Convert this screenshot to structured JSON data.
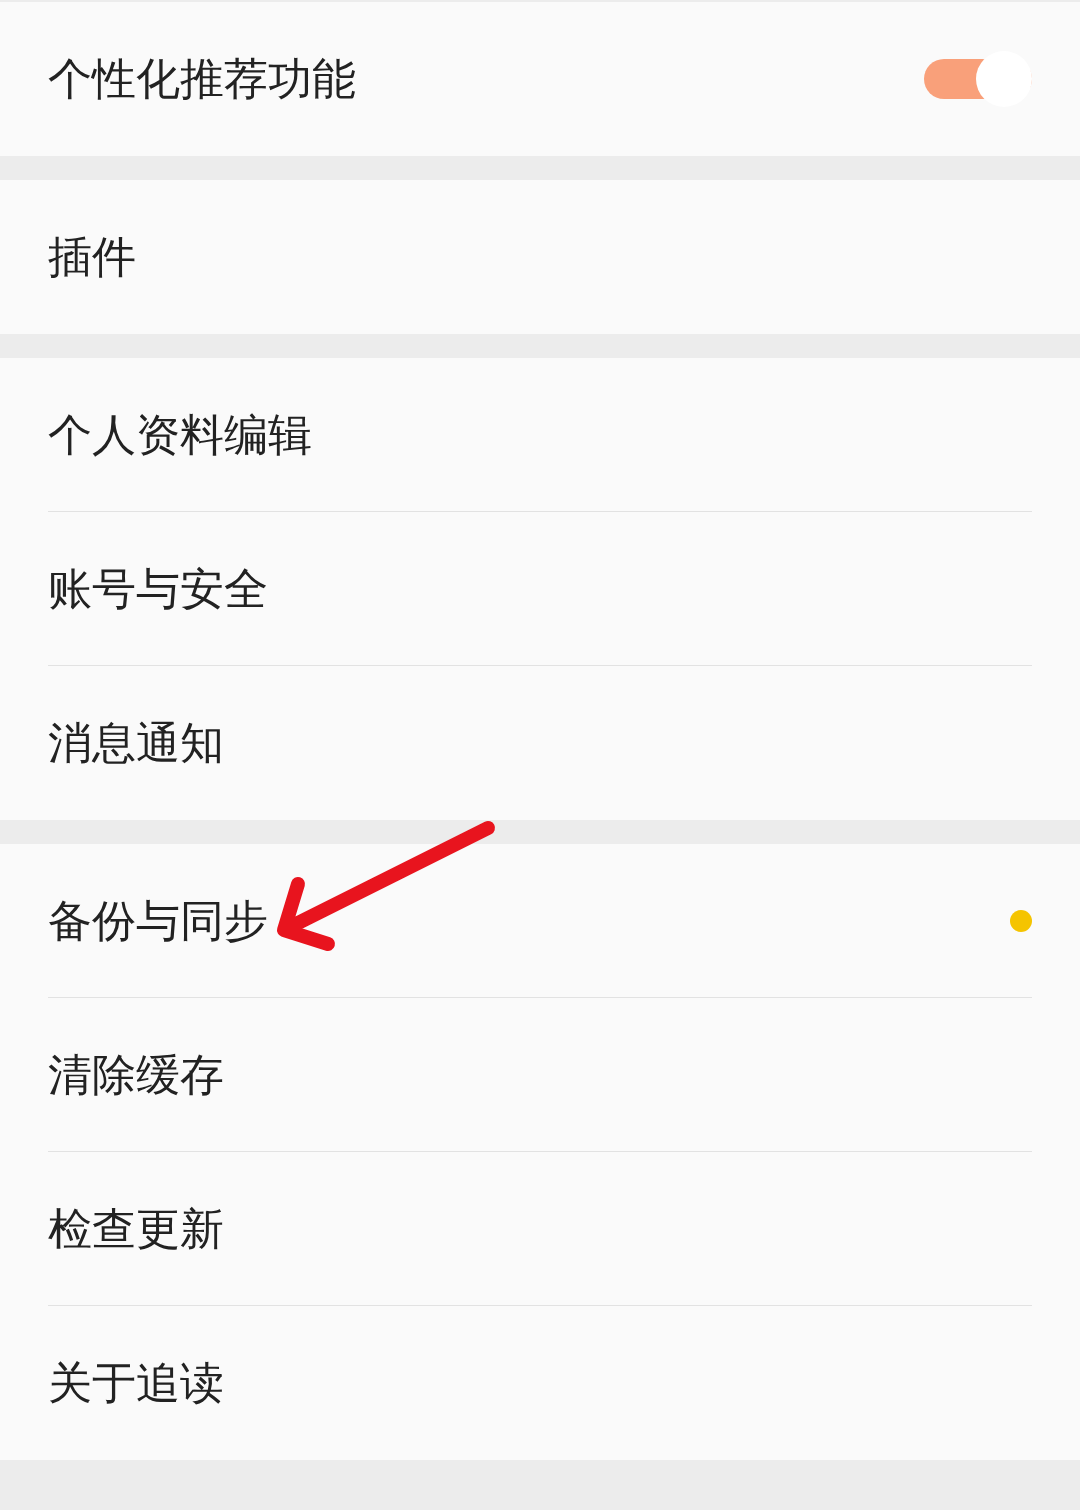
{
  "groups": [
    {
      "items": [
        {
          "label": "个性化推荐功能",
          "kind": "toggle",
          "on": true,
          "dot": false
        }
      ]
    },
    {
      "items": [
        {
          "label": "插件",
          "kind": "link",
          "dot": false
        }
      ]
    },
    {
      "items": [
        {
          "label": "个人资料编辑",
          "kind": "link",
          "dot": false
        },
        {
          "label": "账号与安全",
          "kind": "link",
          "dot": false
        },
        {
          "label": "消息通知",
          "kind": "link",
          "dot": false
        }
      ]
    },
    {
      "items": [
        {
          "label": "备份与同步",
          "kind": "link",
          "dot": true
        },
        {
          "label": "清除缓存",
          "kind": "link",
          "dot": false
        },
        {
          "label": "检查更新",
          "kind": "link",
          "dot": false
        },
        {
          "label": "关于追读",
          "kind": "link",
          "dot": false
        }
      ]
    }
  ]
}
